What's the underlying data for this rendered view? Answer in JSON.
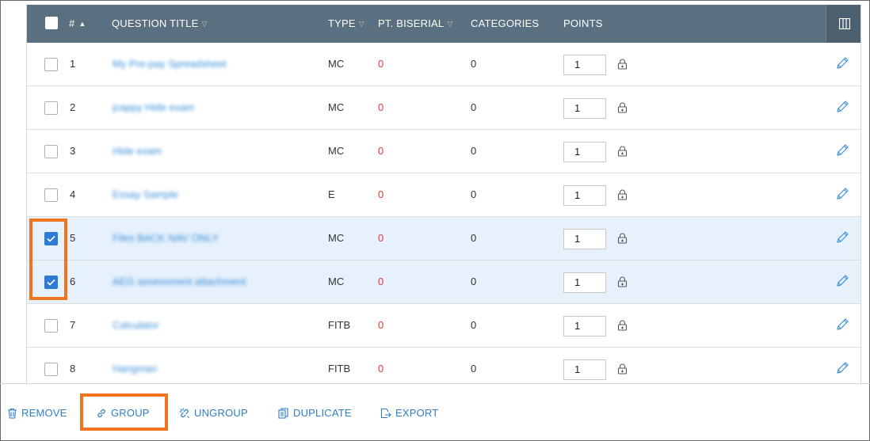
{
  "table": {
    "headers": {
      "number": "#",
      "question_title": "QUESTION TITLE",
      "type": "TYPE",
      "pt_biserial": "PT. BISERIAL",
      "categories": "CATEGORIES",
      "points": "POINTS"
    },
    "rows": [
      {
        "num": "1",
        "title": "My Pre-pay Spreadsheet",
        "type": "MC",
        "pt_biserial": "0",
        "categories": "0",
        "points": "1",
        "checked": false
      },
      {
        "num": "2",
        "title": "jcappy Hide exam",
        "type": "MC",
        "pt_biserial": "0",
        "categories": "0",
        "points": "1",
        "checked": false
      },
      {
        "num": "3",
        "title": "Hide exam",
        "type": "MC",
        "pt_biserial": "0",
        "categories": "0",
        "points": "1",
        "checked": false
      },
      {
        "num": "4",
        "title": "Essay Sample",
        "type": "E",
        "pt_biserial": "0",
        "categories": "0",
        "points": "1",
        "checked": false
      },
      {
        "num": "5",
        "title": "Files BACK NAV ONLY",
        "type": "MC",
        "pt_biserial": "0",
        "categories": "0",
        "points": "1",
        "checked": true
      },
      {
        "num": "6",
        "title": "AEG assessment attachment",
        "type": "MC",
        "pt_biserial": "0",
        "categories": "0",
        "points": "1",
        "checked": true
      },
      {
        "num": "7",
        "title": "Calculator",
        "type": "FITB",
        "pt_biserial": "0",
        "categories": "0",
        "points": "1",
        "checked": false
      },
      {
        "num": "8",
        "title": "Hangman",
        "type": "FITB",
        "pt_biserial": "0",
        "categories": "0",
        "points": "1",
        "checked": false
      }
    ]
  },
  "toolbar": {
    "remove": "REMOVE",
    "group": "GROUP",
    "ungroup": "UNGROUP",
    "duplicate": "DUPLICATE",
    "export": "EXPORT"
  },
  "colors": {
    "header_bg": "#5a6f7f",
    "selected_row": "#e6f1fb",
    "link": "#2f7ec6",
    "pt_biserial_value": "#e23b3b",
    "highlight": "#f07320"
  }
}
